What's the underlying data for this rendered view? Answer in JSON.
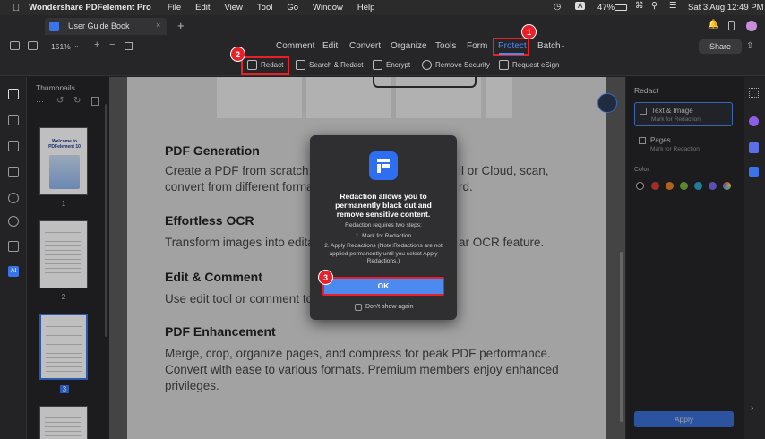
{
  "menubar": {
    "app": "Wondershare PDFelement Pro",
    "items": [
      "File",
      "Edit",
      "View",
      "Tool",
      "Go",
      "Window",
      "Help"
    ],
    "battery": "47%",
    "datetime": "Sat 3 Aug  12:49 PM",
    "input_indicator": "A"
  },
  "tab": {
    "title": "User Guide Book",
    "new_tab": "+"
  },
  "toolbar": {
    "zoom": "151%",
    "menus": [
      "Comment",
      "Edit",
      "Convert",
      "Organize",
      "Tools",
      "Form",
      "Protect",
      "Batch"
    ],
    "share": "Share"
  },
  "subtoolbar": {
    "items": [
      "Redact",
      "Search & Redact",
      "Encrypt",
      "Remove Security",
      "Request eSign"
    ]
  },
  "thumbnails": {
    "title": "Thumbnails",
    "pages": [
      "1",
      "2",
      "3"
    ],
    "page1_title": "Welcome to PDFelement 10"
  },
  "document": {
    "sections": [
      {
        "heading": "PDF Generation",
        "lines": [
          "Create a PDF from scratch, u",
          "convert from different forma"
        ],
        "right": [
          "ll or Cloud, scan,",
          "rd."
        ]
      },
      {
        "heading": "Effortless OCR",
        "lines": [
          "Transform images into editab"
        ],
        "right": [
          "ar OCR feature."
        ]
      },
      {
        "heading": "Edit & Comment",
        "lines": [
          "Use edit tool or comment to"
        ],
        "right": []
      },
      {
        "heading": "PDF Enhancement",
        "lines": [
          "Merge, crop, organize pages, and compress for peak PDF performance.",
          "Convert with ease to various formats. Premium members enjoy enhanced",
          "privileges."
        ],
        "right": []
      }
    ]
  },
  "dialog": {
    "title": "Redaction allows you to permanently black out and remove sensitive content.",
    "steps_intro": "Redaction requires two steps:",
    "step1": "1. Mark for Redaction",
    "step2": "2. Apply Redactions (Note:Redactions are not applied permanently until you select Apply Redactions.)",
    "ok": "OK",
    "dont_show": "Don't show again"
  },
  "right_panel": {
    "title": "Redact",
    "options": [
      {
        "label": "Text & Image",
        "sub": "Mark for Redaction"
      },
      {
        "label": "Pages",
        "sub": "Mark for Redaction"
      }
    ],
    "color_label": "Color",
    "colors": [
      "#111111",
      "#d93a3a",
      "#e8852b",
      "#7cb342",
      "#2fa6c9",
      "#7b68ee",
      "#e0a8b4"
    ],
    "apply": "Apply"
  },
  "callouts": [
    "1",
    "2",
    "3"
  ],
  "colors": {
    "accent": "#3a74e8",
    "callout": "#e8202a"
  }
}
